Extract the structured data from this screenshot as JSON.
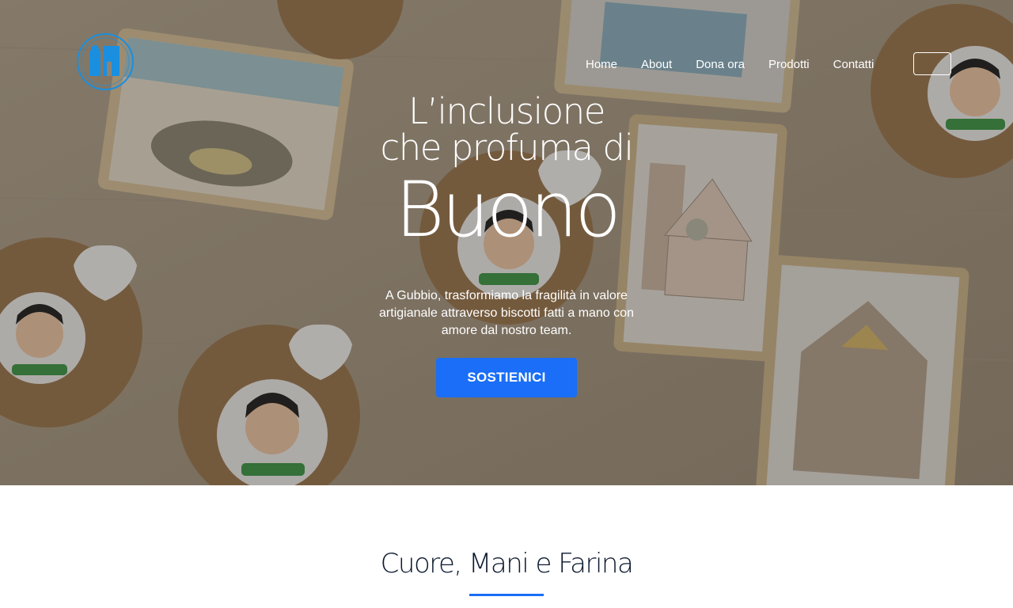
{
  "nav": {
    "items": [
      "Home",
      "About",
      "Dona ora",
      "Prodotti",
      "Contatti"
    ]
  },
  "logo": {
    "icon": "logo-icon",
    "color": "#1a8fe0"
  },
  "hero": {
    "title_line1": "L’inclusione",
    "title_line2": "che profuma di",
    "title_line3": "Buono",
    "subtitle": "A Gubbio, trasformiamo la fragilità in valore artigianale attraverso biscotti fatti a mano con amore dal nostro team.",
    "cta_label": "SOSTIENICI",
    "cta_color": "#1a6ef7"
  },
  "section": {
    "title": "Cuore, Mani e Farina",
    "accent": "#1a6ef7"
  }
}
